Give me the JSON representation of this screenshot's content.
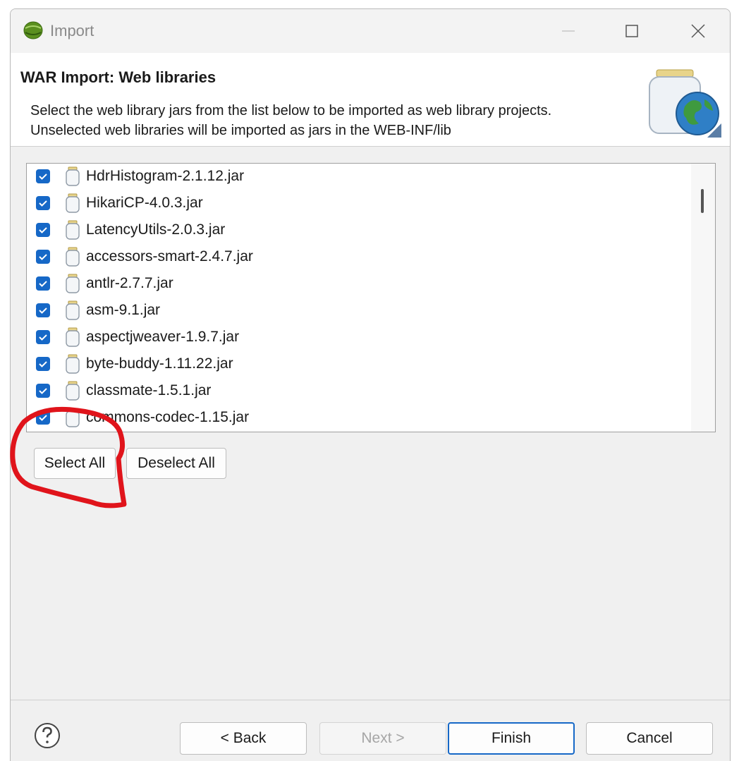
{
  "window": {
    "title": "Import",
    "icons": {
      "app": "eclipse-sphere-icon",
      "minimize": "minimize-icon",
      "maximize": "maximize-icon",
      "close": "close-icon"
    }
  },
  "header": {
    "title": "WAR Import: Web libraries",
    "description": "Select the web library jars from the list below to be imported as web library projects.  Unselected web libraries will be imported as jars in the WEB-INF/lib",
    "icon": "jar-globe-icon"
  },
  "libraries": [
    {
      "name": "HdrHistogram-2.1.12.jar",
      "checked": true
    },
    {
      "name": "HikariCP-4.0.3.jar",
      "checked": true
    },
    {
      "name": "LatencyUtils-2.0.3.jar",
      "checked": true
    },
    {
      "name": "accessors-smart-2.4.7.jar",
      "checked": true
    },
    {
      "name": "antlr-2.7.7.jar",
      "checked": true
    },
    {
      "name": "asm-9.1.jar",
      "checked": true
    },
    {
      "name": "aspectjweaver-1.9.7.jar",
      "checked": true
    },
    {
      "name": "byte-buddy-1.11.22.jar",
      "checked": true
    },
    {
      "name": "classmate-1.5.1.jar",
      "checked": true
    },
    {
      "name": "commons-codec-1.15.jar",
      "checked": true
    }
  ],
  "buttons": {
    "select_all": "Select All",
    "deselect_all": "Deselect All",
    "back": "< Back",
    "next": "Next >",
    "finish": "Finish",
    "cancel": "Cancel"
  },
  "colors": {
    "accent": "#1668c7",
    "annotation": "#e0141b"
  }
}
